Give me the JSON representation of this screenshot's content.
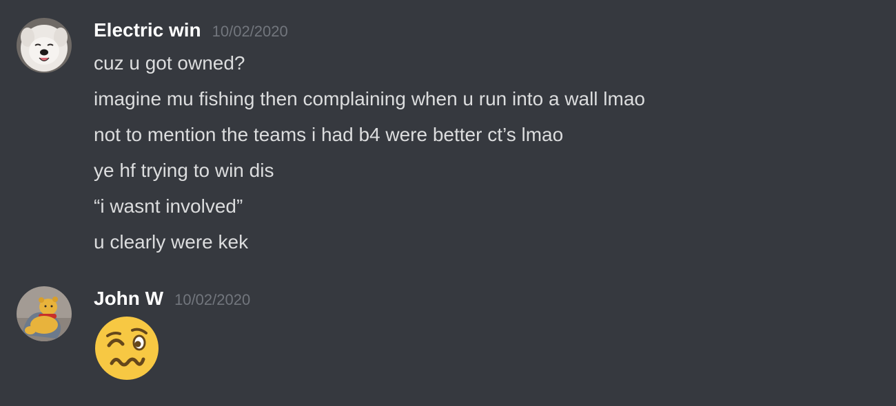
{
  "messages": [
    {
      "username": "Electric win",
      "timestamp": "10/02/2020",
      "avatar_icon": "samoyed-dog-avatar",
      "lines": [
        "cuz u got owned?",
        "imagine mu fishing then complaining when u run into a wall lmao",
        "not to mention the teams i had b4 were better ct’s lmao",
        "ye hf trying to win dis",
        "“i wasnt involved”",
        "u clearly were kek"
      ]
    },
    {
      "username": "John W",
      "timestamp": "10/02/2020",
      "avatar_icon": "winnie-the-pooh-avatar",
      "emoji": "woozy-face-emoji"
    }
  ],
  "colors": {
    "background": "#36393f",
    "username": "#ffffff",
    "timestamp": "#72767d",
    "message_text": "#dcddde",
    "emoji_face": "#f7c843"
  }
}
